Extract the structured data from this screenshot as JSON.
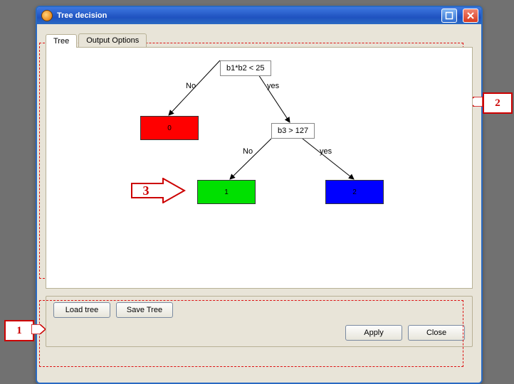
{
  "window": {
    "title": "Tree decision"
  },
  "tabs": [
    {
      "label": "Tree",
      "active": true
    },
    {
      "label": "Output Options",
      "active": false
    }
  ],
  "tree": {
    "root": {
      "label": "b1*b2 < 25"
    },
    "edges": {
      "no": "No",
      "yes": "yes"
    },
    "split2": {
      "label": "b3 > 127"
    },
    "leaves": [
      {
        "value": "0",
        "color": "#ff0000"
      },
      {
        "value": "1",
        "color": "#00e000"
      },
      {
        "value": "2",
        "color": "#0000ff"
      }
    ]
  },
  "buttons": {
    "load": "Load tree",
    "save": "Save Tree",
    "apply": "Apply",
    "close": "Close"
  },
  "annotations": {
    "a1": "1",
    "a2": "2",
    "a3": "3"
  }
}
